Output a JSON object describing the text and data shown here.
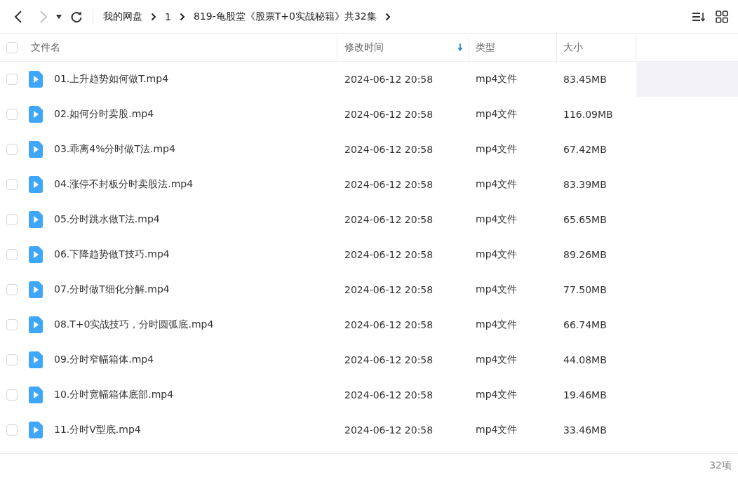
{
  "nav": [
    {
      "kind": "back",
      "disabled": false
    },
    {
      "kind": "forward",
      "disabled": true
    }
  ],
  "breadcrumb": [
    "我的网盘",
    "1",
    "819-龟股堂《股票T+0实战秘籍》共32集"
  ],
  "table": {
    "select_all": {
      "checked": false
    },
    "columns": [
      {
        "label": "文件名",
        "sorted": false
      },
      {
        "label": "修改时间",
        "sorted": true
      },
      {
        "label": "类型",
        "sorted": false
      },
      {
        "label": "大小",
        "sorted": false
      }
    ],
    "rows": [
      {
        "name": "01.上升趋势如何做T.mp4",
        "modified": "2024-06-12 20:58",
        "type": "mp4文件",
        "size": "83.45MB",
        "checked": false,
        "hovered": true
      },
      {
        "name": "02.如何分时卖股.mp4",
        "modified": "2024-06-12 20:58",
        "type": "mp4文件",
        "size": "116.09MB",
        "checked": false,
        "hovered": false
      },
      {
        "name": "03.乖离4%分时做T法.mp4",
        "modified": "2024-06-12 20:58",
        "type": "mp4文件",
        "size": "67.42MB",
        "checked": false,
        "hovered": false
      },
      {
        "name": "04.涨停不封板分时卖股法.mp4",
        "modified": "2024-06-12 20:58",
        "type": "mp4文件",
        "size": "83.39MB",
        "checked": false,
        "hovered": false
      },
      {
        "name": "05.分时跳水做T法.mp4",
        "modified": "2024-06-12 20:58",
        "type": "mp4文件",
        "size": "65.65MB",
        "checked": false,
        "hovered": false
      },
      {
        "name": "06.下降趋势做T技巧.mp4",
        "modified": "2024-06-12 20:58",
        "type": "mp4文件",
        "size": "89.26MB",
        "checked": false,
        "hovered": false
      },
      {
        "name": "07.分时做T细化分解.mp4",
        "modified": "2024-06-12 20:58",
        "type": "mp4文件",
        "size": "77.50MB",
        "checked": false,
        "hovered": false
      },
      {
        "name": "08.T+0实战技巧，分时圆弧底.mp4",
        "modified": "2024-06-12 20:58",
        "type": "mp4文件",
        "size": "66.74MB",
        "checked": false,
        "hovered": false
      },
      {
        "name": "09.分时窄幅箱体.mp4",
        "modified": "2024-06-12 20:58",
        "type": "mp4文件",
        "size": "44.08MB",
        "checked": false,
        "hovered": false
      },
      {
        "name": "10.分时宽幅箱体底部.mp4",
        "modified": "2024-06-12 20:58",
        "type": "mp4文件",
        "size": "19.46MB",
        "checked": false,
        "hovered": false
      },
      {
        "name": "11.分时V型底.mp4",
        "modified": "2024-06-12 20:58",
        "type": "mp4文件",
        "size": "33.46MB",
        "checked": false,
        "hovered": false
      }
    ]
  },
  "status_bar": {
    "count": "32项"
  }
}
